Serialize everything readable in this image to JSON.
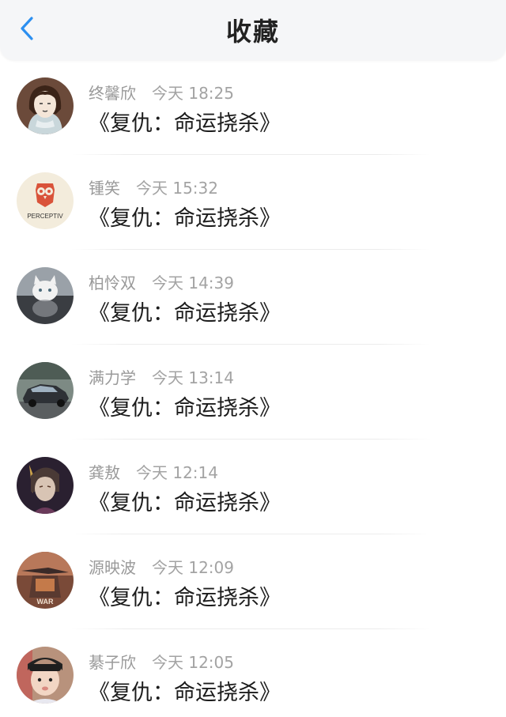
{
  "header": {
    "title": "收藏",
    "back_icon": "chevron-left-icon",
    "accent_color": "#2c8ff0"
  },
  "favorites": [
    {
      "user": "终馨欣",
      "time": "今天 18:25",
      "title": "《复仇：命运挠杀》",
      "avatar": "illustrated-woman-avatar"
    },
    {
      "user": "锺笑",
      "time": "今天 15:32",
      "title": "《复仇：命运挠杀》",
      "avatar": "owl-logo-avatar",
      "avatar_text": "PERCEPTIV"
    },
    {
      "user": "柏怜双",
      "time": "今天 14:39",
      "title": "《复仇：命运挠杀》",
      "avatar": "white-cat-avatar"
    },
    {
      "user": "满力学",
      "time": "今天 13:14",
      "title": "《复仇：命运挠杀》",
      "avatar": "car-photo-avatar"
    },
    {
      "user": "龚敖",
      "time": "今天 12:14",
      "title": "《复仇：命运挠杀》",
      "avatar": "anime-character-avatar"
    },
    {
      "user": "源映波",
      "time": "今天 12:09",
      "title": "《复仇：命运挠杀》",
      "avatar": "war-game-avatar",
      "avatar_text": "WAR"
    },
    {
      "user": "綦子欣",
      "time": "今天 12:05",
      "title": "《复仇：命运挠杀》",
      "avatar": "child-photo-avatar"
    }
  ]
}
